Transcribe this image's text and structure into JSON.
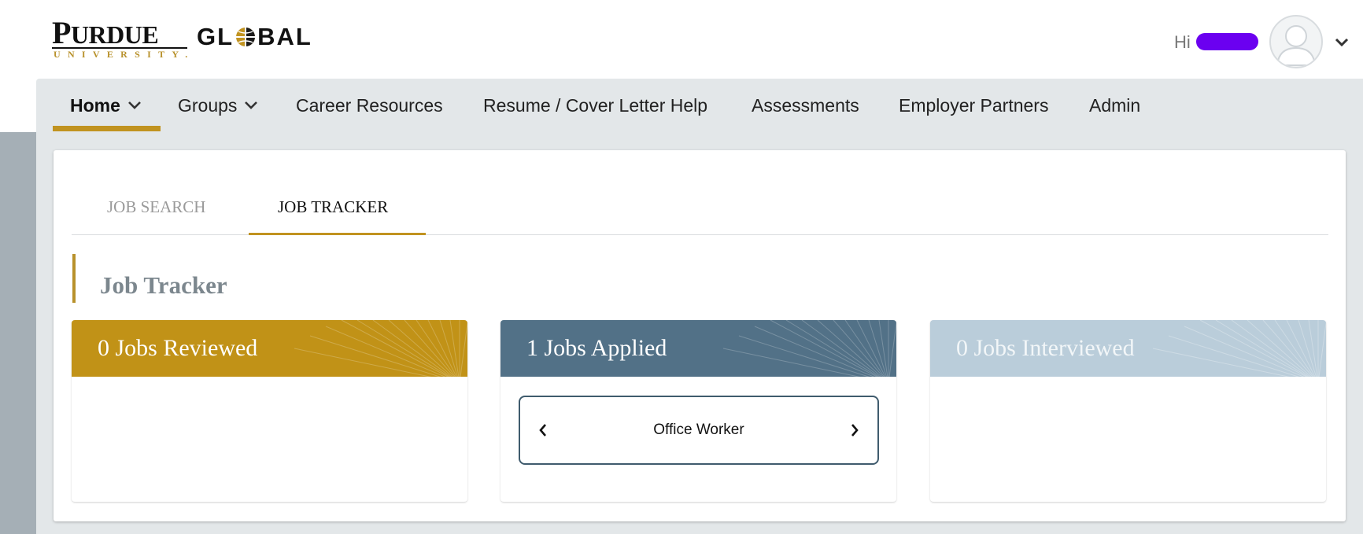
{
  "header": {
    "logo_word_purdue_first": "P",
    "logo_word_purdue_rest": "URDUE",
    "logo_university": "UNIVERSITY.",
    "logo_global_left": "GL",
    "logo_global_right": "BAL",
    "greeting": "Hi"
  },
  "nav": {
    "items": [
      {
        "label": "Home",
        "has_dropdown": true,
        "active": true
      },
      {
        "label": "Groups",
        "has_dropdown": true,
        "active": false
      },
      {
        "label": "Career Resources",
        "has_dropdown": false,
        "active": false
      },
      {
        "label": "Resume / Cover Letter Help",
        "has_dropdown": false,
        "active": false
      },
      {
        "label": "Assessments",
        "has_dropdown": false,
        "active": false
      },
      {
        "label": "Employer Partners",
        "has_dropdown": false,
        "active": false
      },
      {
        "label": "Admin",
        "has_dropdown": false,
        "active": false
      }
    ]
  },
  "tabs": {
    "job_search": "JOB SEARCH",
    "job_tracker": "JOB TRACKER",
    "selected": "JOB TRACKER"
  },
  "section": {
    "title": "Job Tracker"
  },
  "panels": {
    "reviewed": {
      "title": "0 Jobs Reviewed"
    },
    "applied": {
      "title": "1 Jobs Applied",
      "jobs": [
        "Office Worker"
      ]
    },
    "interviewed": {
      "title": "0 Jobs Interviewed"
    }
  },
  "colors": {
    "gold": "#c19217",
    "slate": "#527187",
    "light_blue": "#bacdda",
    "nav_bg": "#e3e7e9"
  },
  "icons": {
    "dropdown": "chevron-down-icon",
    "prev": "chevron-left-icon",
    "next": "chevron-right-icon",
    "avatar": "user-silhouette-icon"
  }
}
